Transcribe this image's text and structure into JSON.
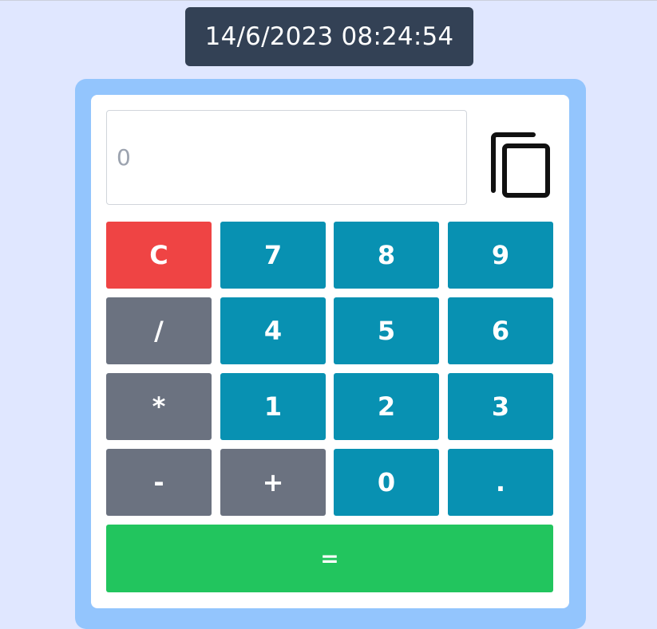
{
  "header": {
    "datetime": "14/6/2023 08:24:54"
  },
  "display": {
    "placeholder": "0",
    "value": ""
  },
  "icons": {
    "copy": "copy-icon"
  },
  "keys": {
    "clear": "C",
    "seven": "7",
    "eight": "8",
    "nine": "9",
    "divide": "/",
    "four": "4",
    "five": "5",
    "six": "6",
    "multiply": "*",
    "one": "1",
    "two": "2",
    "three": "3",
    "minus": "-",
    "plus": "+",
    "zero": "0",
    "dot": ".",
    "equals": "="
  },
  "colors": {
    "background": "#e0e7ff",
    "frame": "#93c5fd",
    "datetime_bg": "#334155",
    "number_key": "#0891b2",
    "operator_key": "#6b7280",
    "clear_key": "#ef4444",
    "equals_key": "#22c55e"
  }
}
